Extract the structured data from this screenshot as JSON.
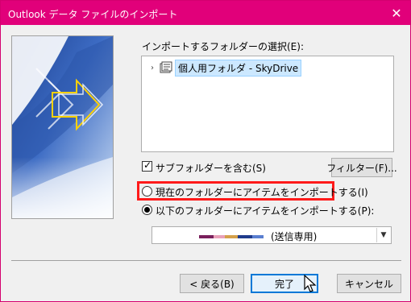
{
  "window": {
    "title": "Outlook データ ファイルのインポート",
    "close_glyph": "✕"
  },
  "folder_select": {
    "label": "インポートするフォルダーの選択(E):",
    "tree_item": "個人用フォルダ - SkyDrive",
    "expander_glyph": "›"
  },
  "include_subfolders": {
    "label": "サブフォルダーを含む(S)",
    "checked": true
  },
  "filter_button": "フィルター(F)...",
  "import_current": {
    "label": "現在のフォルダーにアイテムをインポートする(I)",
    "selected": false
  },
  "import_below": {
    "label": "以下のフォルダーにアイテムをインポートする(P):",
    "selected": true
  },
  "target_combo": {
    "value": "(送信専用)",
    "arrow_glyph": "▼"
  },
  "buttons": {
    "back": "< 戻る(B)",
    "finish": "完了",
    "cancel": "キャンセル"
  },
  "colors": {
    "titlebar": "#e1007a",
    "highlight_border": "#ff1a1a",
    "selection_fill": "#cce8ff",
    "swatches": [
      "#7a1f5c",
      "#e8a0b8",
      "#d4a04a",
      "#1f3b8c",
      "#5a7fd0"
    ]
  },
  "icons": {
    "close": "close-icon",
    "folder": "pst-folder-icon",
    "cursor": "mouse-pointer-icon"
  }
}
